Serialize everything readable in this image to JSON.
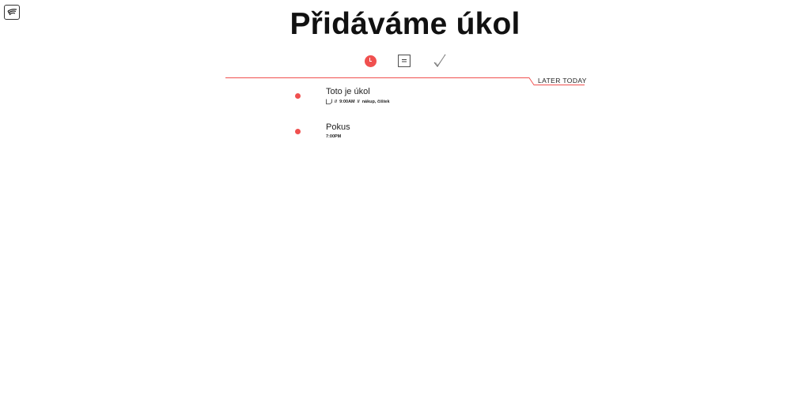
{
  "app": {
    "logo_icon": "wing-logo-icon"
  },
  "header": {
    "title": "Přidáváme úkol"
  },
  "tabs": [
    {
      "name": "clock-tab",
      "icon": "clock-icon",
      "active": true
    },
    {
      "name": "list-tab",
      "icon": "list-icon",
      "active": false
    },
    {
      "name": "done-tab",
      "icon": "checkmark-icon",
      "active": false
    }
  ],
  "section": {
    "label": "LATER TODAY"
  },
  "tasks": [
    {
      "title": "Toto je úkol",
      "meta": {
        "sep1": "//",
        "time": "9:00AM",
        "sep2": "//",
        "tags": "nákup, čištek"
      },
      "has_note_icon": true
    },
    {
      "title": "Pokus",
      "meta": {
        "time": "7:00PM"
      },
      "has_note_icon": false
    }
  ],
  "colors": {
    "accent": "#f0504f",
    "text": "#1a1a1a",
    "background": "#ffffff"
  }
}
